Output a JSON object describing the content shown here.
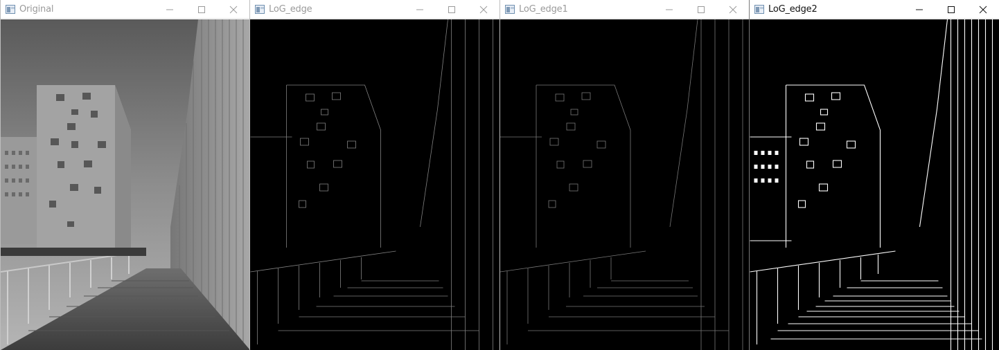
{
  "windows": [
    {
      "title": "Original",
      "active": false
    },
    {
      "title": "LoG_edge",
      "active": false
    },
    {
      "title": "LoG_edge1",
      "active": false
    },
    {
      "title": "LoG_edge2",
      "active": true
    }
  ],
  "icons": {
    "app": "window-app-icon",
    "minimize": "minimize-icon",
    "maximize": "maximize-icon",
    "close": "close-icon"
  },
  "colors": {
    "titlebar_bg": "#ffffff",
    "inactive_title": "#9a9a9a",
    "active_title": "#111111",
    "edge_bg": "#000000",
    "edge_lines": "#ffffff"
  }
}
